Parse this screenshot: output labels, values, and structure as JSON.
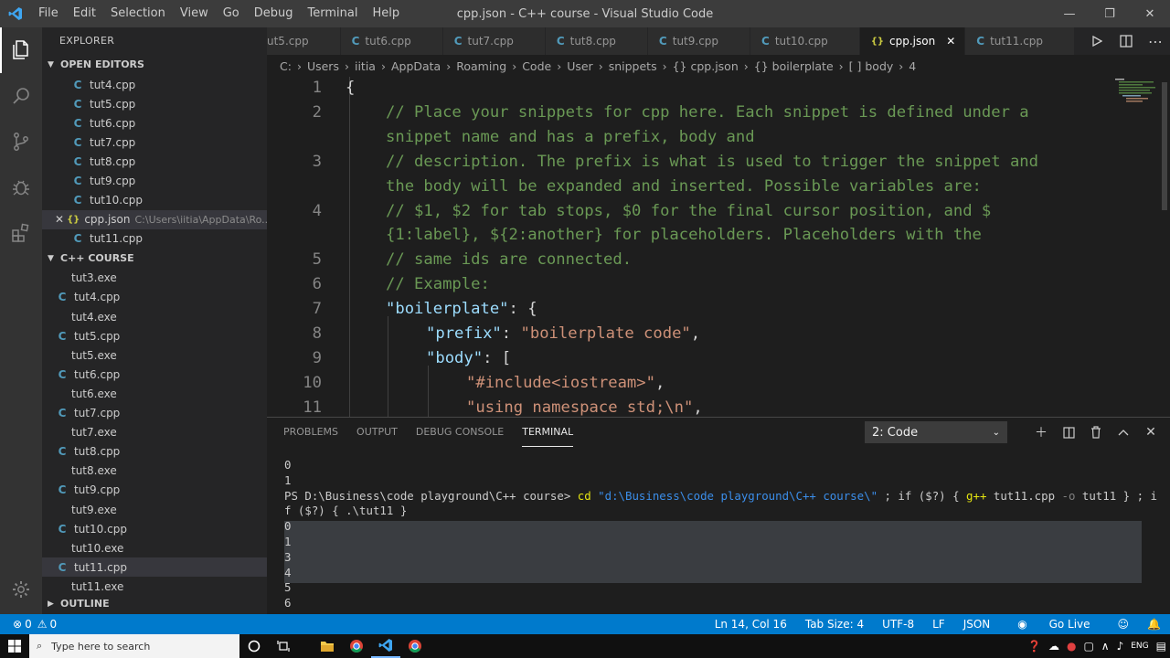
{
  "window": {
    "title": "cpp.json - C++ course - Visual Studio Code",
    "menu": [
      "File",
      "Edit",
      "Selection",
      "View",
      "Go",
      "Debug",
      "Terminal",
      "Help"
    ]
  },
  "sidebar": {
    "title": "EXPLORER",
    "open_editors_label": "OPEN EDITORS",
    "open_editors": [
      {
        "name": "tut4.cpp",
        "type": "cpp"
      },
      {
        "name": "tut5.cpp",
        "type": "cpp"
      },
      {
        "name": "tut6.cpp",
        "type": "cpp"
      },
      {
        "name": "tut7.cpp",
        "type": "cpp"
      },
      {
        "name": "tut8.cpp",
        "type": "cpp"
      },
      {
        "name": "tut9.cpp",
        "type": "cpp"
      },
      {
        "name": "tut10.cpp",
        "type": "cpp"
      },
      {
        "name": "cpp.json",
        "type": "json",
        "path": "C:\\Users\\iitia\\AppData\\Ro...",
        "selected": true
      },
      {
        "name": "tut11.cpp",
        "type": "cpp"
      }
    ],
    "folder_label": "C++ COURSE",
    "files": [
      {
        "name": "tut3.exe",
        "type": "exe"
      },
      {
        "name": "tut4.cpp",
        "type": "cpp"
      },
      {
        "name": "tut4.exe",
        "type": "exe"
      },
      {
        "name": "tut5.cpp",
        "type": "cpp"
      },
      {
        "name": "tut5.exe",
        "type": "exe"
      },
      {
        "name": "tut6.cpp",
        "type": "cpp"
      },
      {
        "name": "tut6.exe",
        "type": "exe"
      },
      {
        "name": "tut7.cpp",
        "type": "cpp"
      },
      {
        "name": "tut7.exe",
        "type": "exe"
      },
      {
        "name": "tut8.cpp",
        "type": "cpp"
      },
      {
        "name": "tut8.exe",
        "type": "exe"
      },
      {
        "name": "tut9.cpp",
        "type": "cpp"
      },
      {
        "name": "tut9.exe",
        "type": "exe"
      },
      {
        "name": "tut10.cpp",
        "type": "cpp"
      },
      {
        "name": "tut10.exe",
        "type": "exe"
      },
      {
        "name": "tut11.cpp",
        "type": "cpp",
        "selected": true
      },
      {
        "name": "tut11.exe",
        "type": "exe"
      }
    ],
    "outline_label": "OUTLINE"
  },
  "tabs": [
    {
      "label": "ut5.cpp",
      "type": "cpp"
    },
    {
      "label": "tut6.cpp",
      "type": "cpp"
    },
    {
      "label": "tut7.cpp",
      "type": "cpp"
    },
    {
      "label": "tut8.cpp",
      "type": "cpp"
    },
    {
      "label": "tut9.cpp",
      "type": "cpp"
    },
    {
      "label": "tut10.cpp",
      "type": "cpp"
    },
    {
      "label": "cpp.json",
      "type": "json",
      "active": true
    },
    {
      "label": "tut11.cpp",
      "type": "cpp"
    }
  ],
  "breadcrumb": [
    "C:",
    "Users",
    "iitia",
    "AppData",
    "Roaming",
    "Code",
    "User",
    "snippets",
    "{} cpp.json",
    "{} boilerplate",
    "[ ] body",
    "4"
  ],
  "editor": {
    "lines": [
      {
        "n": "1",
        "indent": 0,
        "parts": [
          {
            "t": "{",
            "c": "c-punc"
          }
        ]
      },
      {
        "n": "2",
        "indent": 1,
        "parts": [
          {
            "t": "// Place your snippets for cpp here. Each snippet is defined under a",
            "c": "c-comment"
          }
        ]
      },
      {
        "n": "",
        "indent": 1,
        "parts": [
          {
            "t": "snippet name and has a prefix, body and",
            "c": "c-comment"
          }
        ]
      },
      {
        "n": "3",
        "indent": 1,
        "parts": [
          {
            "t": "// description. The prefix is what is used to trigger the snippet and",
            "c": "c-comment"
          }
        ]
      },
      {
        "n": "",
        "indent": 1,
        "parts": [
          {
            "t": "the body will be expanded and inserted. Possible variables are:",
            "c": "c-comment"
          }
        ]
      },
      {
        "n": "4",
        "indent": 1,
        "parts": [
          {
            "t": "// $1, $2 for tab stops, $0 for the final cursor position, and $",
            "c": "c-comment"
          }
        ]
      },
      {
        "n": "",
        "indent": 1,
        "parts": [
          {
            "t": "{1:label}, ${2:another} for placeholders. Placeholders with the",
            "c": "c-comment"
          }
        ]
      },
      {
        "n": "5",
        "indent": 1,
        "parts": [
          {
            "t": "// same ids are connected.",
            "c": "c-comment"
          }
        ]
      },
      {
        "n": "6",
        "indent": 1,
        "parts": [
          {
            "t": "// Example:",
            "c": "c-comment"
          }
        ]
      },
      {
        "n": "7",
        "indent": 1,
        "parts": [
          {
            "t": "\"boilerplate\"",
            "c": "c-key"
          },
          {
            "t": ": {",
            "c": "c-punc"
          }
        ]
      },
      {
        "n": "8",
        "indent": 2,
        "parts": [
          {
            "t": "\"prefix\"",
            "c": "c-key"
          },
          {
            "t": ": ",
            "c": "c-punc"
          },
          {
            "t": "\"boilerplate code\"",
            "c": "c-str"
          },
          {
            "t": ",",
            "c": "c-punc"
          }
        ]
      },
      {
        "n": "9",
        "indent": 2,
        "parts": [
          {
            "t": "\"body\"",
            "c": "c-key"
          },
          {
            "t": ": ",
            "c": "c-punc"
          },
          {
            "t": "[",
            "c": "c-punc"
          }
        ]
      },
      {
        "n": "10",
        "indent": 3,
        "parts": [
          {
            "t": "\"#include<iostream>\"",
            "c": "c-str"
          },
          {
            "t": ",",
            "c": "c-punc"
          }
        ]
      },
      {
        "n": "11",
        "indent": 3,
        "parts": [
          {
            "t": "\"using namespace std;\\n\"",
            "c": "c-str"
          },
          {
            "t": ",",
            "c": "c-punc"
          }
        ]
      }
    ]
  },
  "panel": {
    "tabs": [
      "PROBLEMS",
      "OUTPUT",
      "DEBUG CONSOLE",
      "TERMINAL"
    ],
    "active_tab": "TERMINAL",
    "terminal_select": "2: Code",
    "terminal_lines": [
      "0",
      "1"
    ],
    "prompt": "PS D:\\Business\\code playground\\C++ course>",
    "command_cd": "cd",
    "command_path": "\"d:\\Business\\code playground\\C++ course\\\"",
    "command_mid1": "; if ($?) {",
    "command_gpp": "g++",
    "command_mid2": "tut11.cpp",
    "command_o": "-o",
    "command_mid3": "tut11 } ; i",
    "command_wrap": "f ($?) { .\\tut11 }",
    "output_lines": [
      "0",
      "1",
      "3",
      "4",
      "5",
      "6"
    ]
  },
  "status": {
    "errors": "0",
    "warnings": "0",
    "position": "Ln 14, Col 16",
    "tab_size": "Tab Size: 4",
    "encoding": "UTF-8",
    "eol": "LF",
    "language": "JSON",
    "go_live": "Go Live"
  },
  "taskbar": {
    "search_placeholder": "Type here to search",
    "lang": "ENG"
  }
}
